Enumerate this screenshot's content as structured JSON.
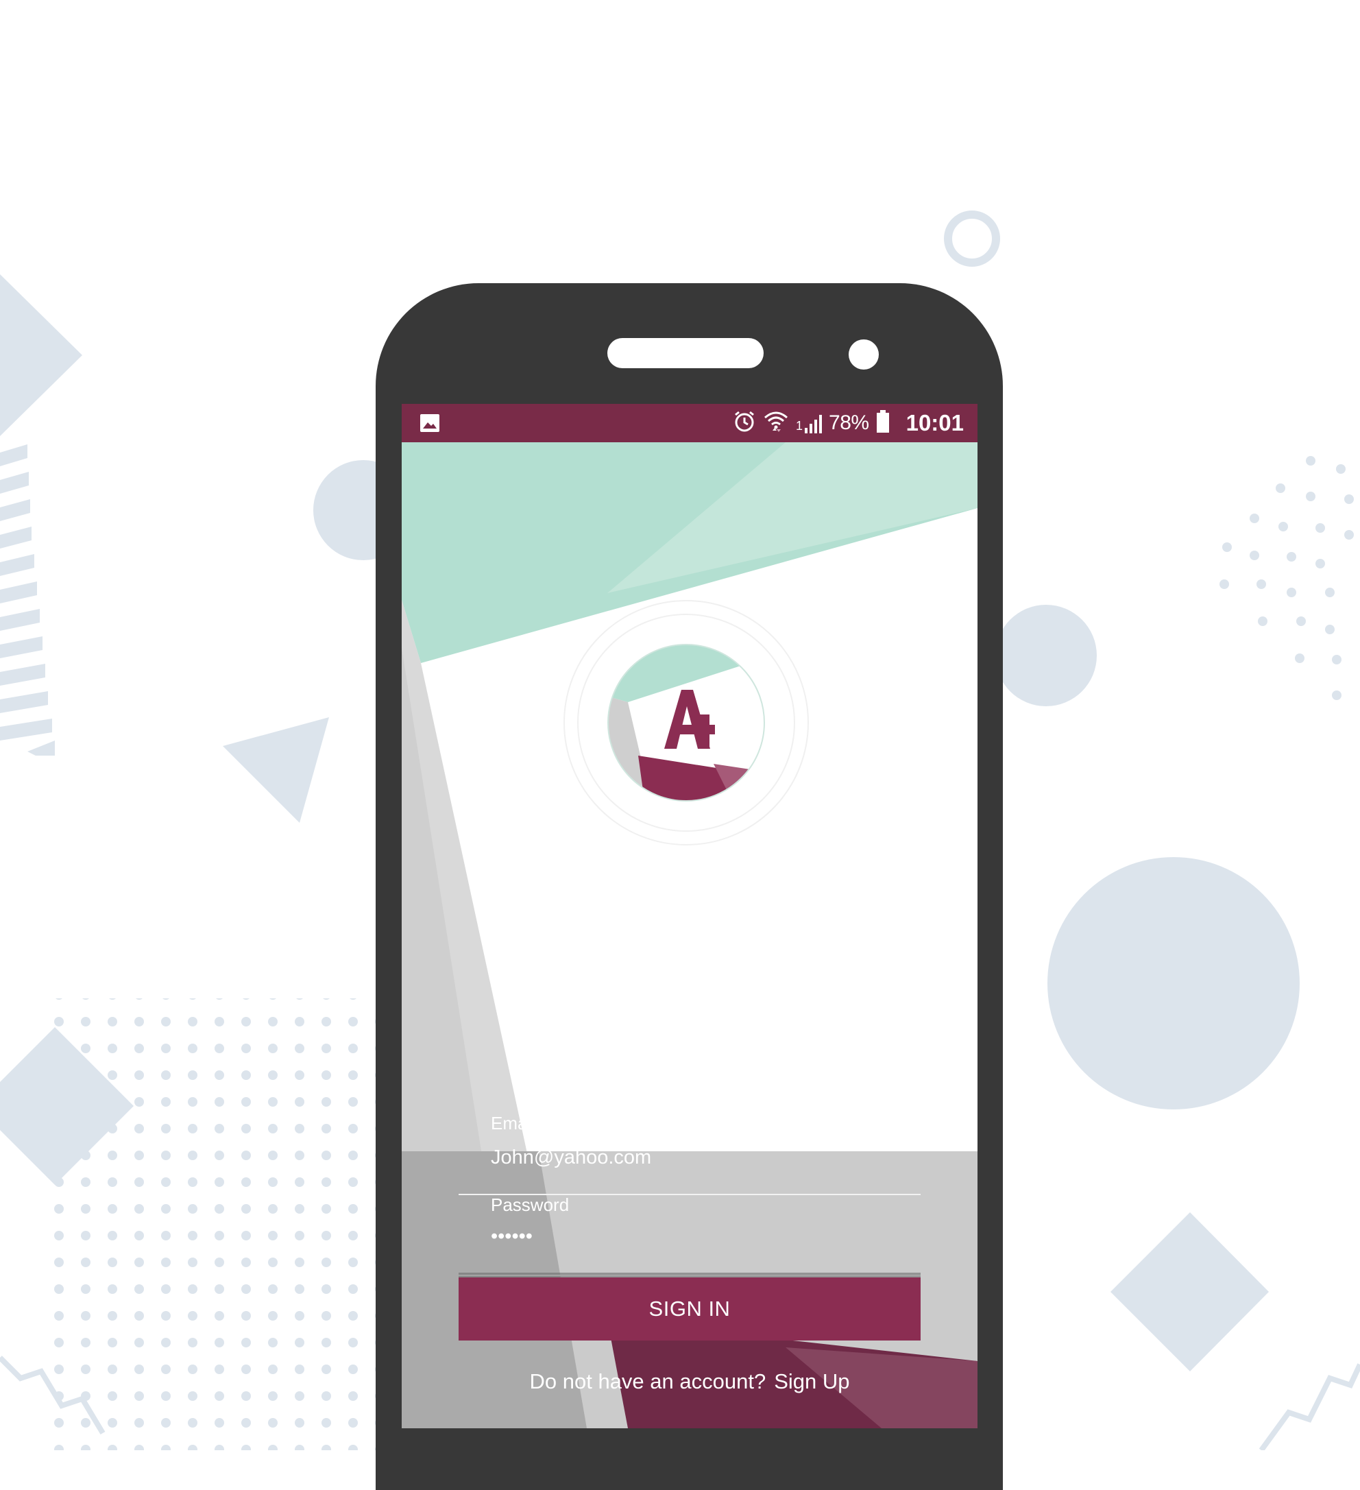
{
  "colors": {
    "brand": "#8b2d52",
    "status_bar": "#792b48",
    "mint": "#b3dfd1",
    "phone_body": "#383838",
    "decor": "#dce4ec"
  },
  "status_bar": {
    "left_icon": "image-icon",
    "icons": [
      "alarm-icon",
      "wifi-icon",
      "signal-icon",
      "battery-icon"
    ],
    "signal_sim": "1",
    "battery": "78%",
    "time": "10:01"
  },
  "logo": {
    "icon": "a-plus-logo",
    "letter": "A"
  },
  "form": {
    "email_label": "Email",
    "email_value": "John@yahoo.com",
    "password_label": "Password",
    "password_value": "••••••",
    "signin_label": "SIGN IN"
  },
  "footer": {
    "prompt": "Do not have an account?",
    "signup_label": "Sign Up"
  }
}
